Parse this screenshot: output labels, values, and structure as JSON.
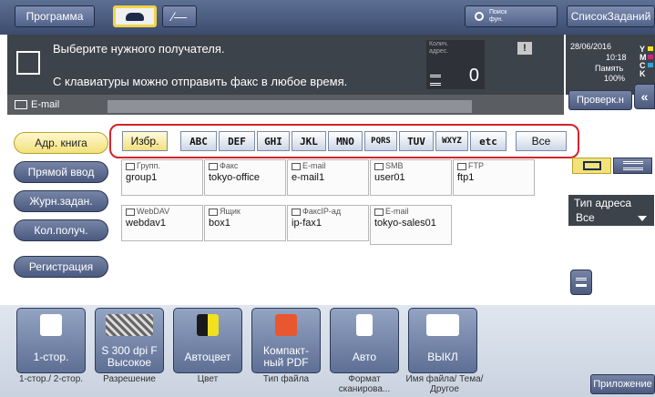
{
  "topbar": {
    "program": "Программа",
    "search_label": "Поиск фун.",
    "job_list": "СписокЗаданий"
  },
  "info": {
    "line1": "Выберите нужного получателя.",
    "line2": "С клавиатуры можно отправить факс в любое время.",
    "count_label": "Колич. адрес.",
    "count_value": "0"
  },
  "status": {
    "datetime": "28/06/2016",
    "time": "10:18",
    "memory_label": "Память",
    "memory_value": "100%",
    "toner_letters": [
      "Y",
      "M",
      "C",
      "K"
    ]
  },
  "tabbar": {
    "email_tab": "E-mail",
    "check_btn": "Проверк.н"
  },
  "sidebar": [
    {
      "label": "Адр. книга",
      "active": true
    },
    {
      "label": "Прямой ввод",
      "active": false
    },
    {
      "label": "Журн.задан.",
      "active": false
    },
    {
      "label": "Кол.получ.",
      "active": false
    },
    {
      "label": "Регистрация",
      "active": false
    }
  ],
  "filters": [
    "Избр.",
    "ABC",
    "DEF",
    "GHI",
    "JKL",
    "MNO",
    "PQRS",
    "TUV",
    "WXYZ",
    "etc",
    "Все"
  ],
  "cards": [
    {
      "type": "Групп.",
      "name": "group1"
    },
    {
      "type": "Факс",
      "name": "tokyo-office"
    },
    {
      "type": "E-mail",
      "name": "e-mail1"
    },
    {
      "type": "SMB",
      "name": "user01"
    },
    {
      "type": "FTP",
      "name": "ftp1"
    },
    {
      "type": "WebDAV",
      "name": "webdav1"
    },
    {
      "type": "Ящик",
      "name": "box1"
    },
    {
      "type": "ФаксIP-ад",
      "name": "ip-fax1"
    },
    {
      "type": "E-mail",
      "name": "tokyo-sales01"
    }
  ],
  "right": {
    "addr_type_label": "Тип адреса",
    "addr_type_value": "Все"
  },
  "functions": [
    {
      "label": "1-стор.",
      "caption": "1-стор./ 2-стор."
    },
    {
      "label": "S 300 dpi F Высокое",
      "caption": "Разрешение"
    },
    {
      "label": "Автоцвет",
      "caption": "Цвет"
    },
    {
      "label": "Компакт- ный PDF",
      "caption": "Тип файла"
    },
    {
      "label": "Авто",
      "caption": "Формат сканирова..."
    },
    {
      "label": "ВЫКЛ",
      "caption": "Имя файла/ Тема/Другое"
    }
  ],
  "app_button": "Приложение",
  "colors": {
    "highlight": "#d6222a",
    "active": "#f2e27a",
    "bar": "#3d434b"
  }
}
